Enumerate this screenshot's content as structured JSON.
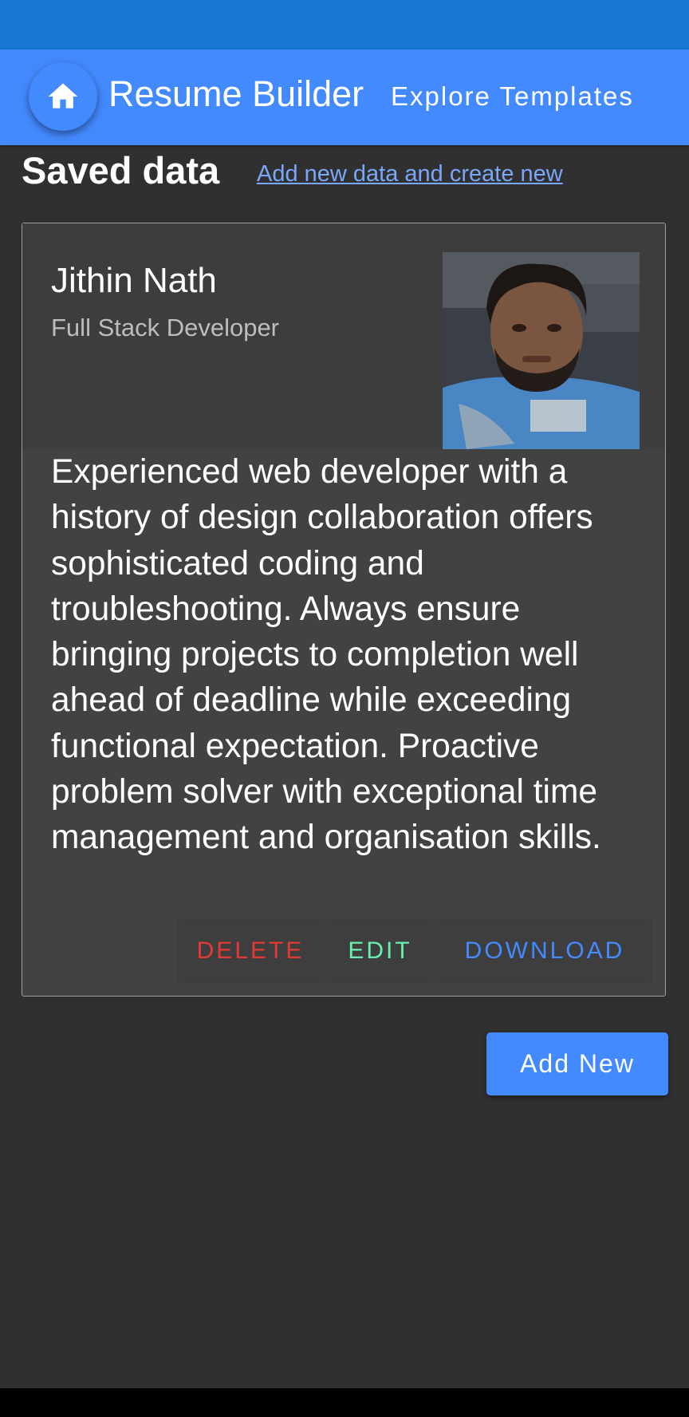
{
  "app_bar": {
    "title": "Resume Builder",
    "explore_label": "Explore Templates",
    "home_icon": "home-icon"
  },
  "page": {
    "title": "Saved data",
    "add_link": "Add new data and create new"
  },
  "resume_card": {
    "name": "Jithin Nath",
    "role": "Full Stack Developer",
    "photo": "profile-photo",
    "summary": "Experienced web developer with a history of design collaboration offers sophisticated coding and troubleshooting. Always ensure bringing projects to completion well ahead of deadline while exceeding functional expectation. Proactive problem solver with exceptional time management and organisation skills.",
    "actions": {
      "delete": "DELETE",
      "edit": "EDIT",
      "download": "DOWNLOAD"
    }
  },
  "add_new_button": "Add New",
  "colors": {
    "primary": "#448aff",
    "status_bar": "#1976d2",
    "background": "#303030",
    "card": "#424242",
    "delete": "#e53935",
    "edit": "#69f0ae",
    "link": "#7aa7f7"
  }
}
